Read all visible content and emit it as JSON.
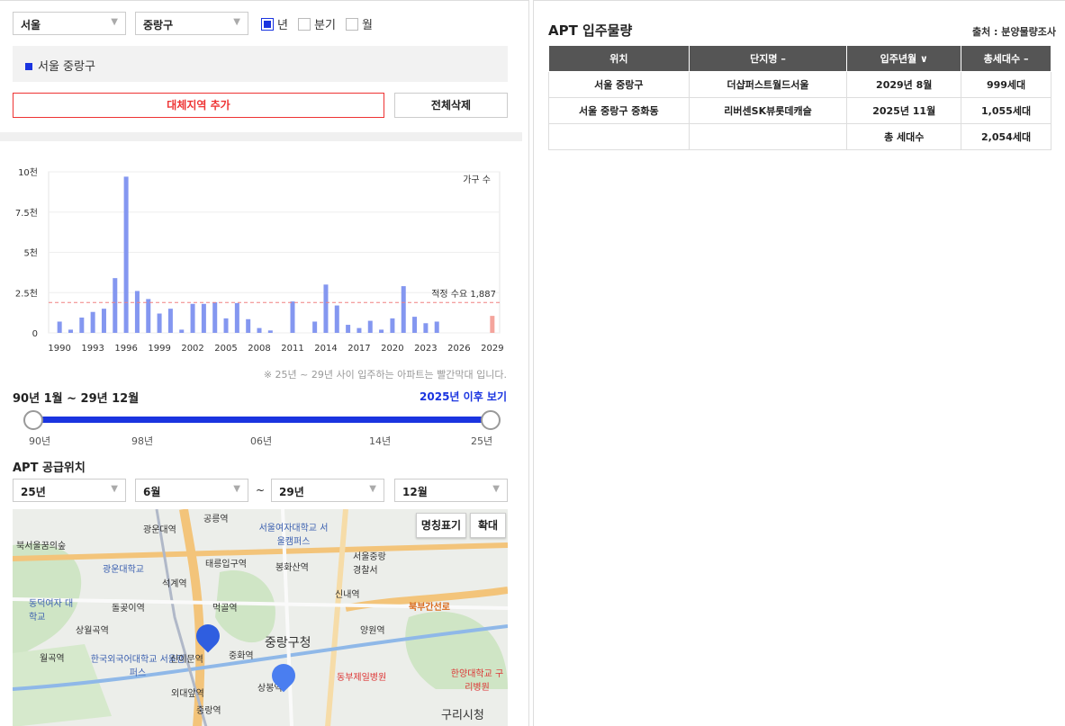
{
  "filters": {
    "city": "서울",
    "district": "중랑구",
    "opts": [
      {
        "label": "년",
        "checked": true
      },
      {
        "label": "분기",
        "checked": false
      },
      {
        "label": "월",
        "checked": false
      }
    ]
  },
  "region_tag": "서울 중랑구",
  "buttons": {
    "add": "대체지역 추가",
    "clear": "전체삭제"
  },
  "chart_data": {
    "type": "bar",
    "ylabel": "가구 수",
    "yticks": [
      "0",
      "2.5천",
      "5천",
      "7.5천",
      "10천"
    ],
    "ylim": [
      0,
      10000
    ],
    "xticks": [
      "1990",
      "1993",
      "1996",
      "1999",
      "2002",
      "2005",
      "2008",
      "2011",
      "2014",
      "2017",
      "2020",
      "2023",
      "2026",
      "2029"
    ],
    "x": [
      1990,
      1991,
      1992,
      1993,
      1994,
      1995,
      1996,
      1997,
      1998,
      1999,
      2000,
      2001,
      2002,
      2003,
      2004,
      2005,
      2006,
      2007,
      2008,
      2009,
      2010,
      2011,
      2012,
      2013,
      2014,
      2015,
      2016,
      2017,
      2018,
      2019,
      2020,
      2021,
      2022,
      2023,
      2024,
      2025,
      2026,
      2027,
      2028,
      2029
    ],
    "values": [
      700,
      200,
      950,
      1300,
      1500,
      3400,
      9700,
      2600,
      2100,
      1200,
      1500,
      200,
      1800,
      1800,
      1900,
      900,
      1850,
      850,
      300,
      150,
      0,
      1950,
      0,
      700,
      3000,
      1700,
      500,
      300,
      750,
      200,
      900,
      2900,
      1000,
      600,
      700,
      0,
      0,
      0,
      0,
      1055
    ],
    "highlight_from": 2025,
    "reference": {
      "label": "적정 수요 1,887",
      "value": 1887
    },
    "colors": {
      "bar": "#8497f0",
      "future": "#f4a49c",
      "ref": "#f08080"
    }
  },
  "chart_note": "※ 25년 ~ 29년 사이 입주하는 아파트는 빨간막대 입니다.",
  "range": {
    "label": "90년 1월 ~ 29년 12월",
    "after_link": "2025년 이후 보기",
    "ticks": [
      "90년",
      "98년",
      "06년",
      "14년",
      "25년"
    ]
  },
  "supply": {
    "title": "APT 공급위치",
    "from_year": "25년",
    "from_month": "6월",
    "sep": "~",
    "to_year": "29년",
    "to_month": "12월"
  },
  "map": {
    "btn_names": "명칭표기",
    "btn_zoom": "확대",
    "labels": [
      "광운대역",
      "공릉역",
      "북서울꿈의숲",
      "서울여자대학교 서울캠퍼스",
      "서울중랑 경찰서",
      "광운대학교",
      "태릉입구역",
      "봉화산역",
      "석계역",
      "신내역",
      "북부간선로",
      "돌곶이역",
      "먹골역",
      "동덕여자 대학교",
      "상월곡역",
      "중랑구청",
      "양원역",
      "월곡역",
      "한국외국어대학교 서울캠퍼스",
      "신이문역",
      "중화역",
      "상봉역",
      "동부제일병원",
      "한양대학교 구리병원",
      "외대앞역",
      "중랑역",
      "구리시청"
    ]
  },
  "right": {
    "title": "APT 입주물량",
    "source": "출처 : 분양물량조사",
    "headers": [
      "위치",
      "단지명 –",
      "입주년월 ∨",
      "총세대수 –"
    ],
    "rows": [
      [
        "서울 중랑구",
        "더샵퍼스트월드서울",
        "2029년 8월",
        "999세대"
      ],
      [
        "서울 중랑구 중화동",
        "리버센SK뷰롯데캐슬",
        "2025년 11월",
        "1,055세대"
      ],
      [
        "",
        "",
        "총 세대수",
        "2,054세대"
      ]
    ]
  }
}
